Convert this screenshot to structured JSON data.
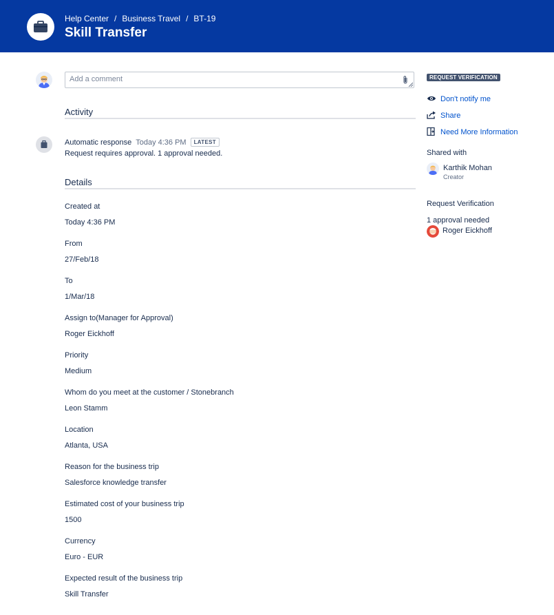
{
  "header": {
    "breadcrumbs": [
      "Help Center",
      "Business Travel",
      "BT-19"
    ],
    "title": "Skill Transfer"
  },
  "comment": {
    "placeholder": "Add a comment"
  },
  "activity": {
    "heading": "Activity",
    "entry": {
      "author": "Automatic response",
      "time": "Today 4:36 PM",
      "badge": "LATEST",
      "message": "Request requires approval. 1 approval needed."
    }
  },
  "details": {
    "heading": "Details",
    "fields": [
      {
        "label": "Created at",
        "value": "Today 4:36 PM"
      },
      {
        "label": "From",
        "value": "27/Feb/18"
      },
      {
        "label": "To",
        "value": "1/Mar/18"
      },
      {
        "label": "Assign to(Manager for Approval)",
        "value": "Roger Eickhoff"
      },
      {
        "label": "Priority",
        "value": "Medium"
      },
      {
        "label": "Whom do you meet at the customer / Stonebranch",
        "value": "Leon Stamm"
      },
      {
        "label": "Location",
        "value": "Atlanta, USA"
      },
      {
        "label": "Reason for the business trip",
        "value": "Salesforce knowledge transfer"
      },
      {
        "label": "Estimated cost of your business trip",
        "value": "1500"
      },
      {
        "label": "Currency",
        "value": "Euro - EUR"
      },
      {
        "label": "Expected result of the business trip",
        "value": "Skill Transfer"
      }
    ]
  },
  "sidebar": {
    "status": "REQUEST VERIFICATION",
    "actions": [
      {
        "label": "Don't notify me",
        "icon": "eye-icon"
      },
      {
        "label": "Share",
        "icon": "share-icon"
      },
      {
        "label": "Need More Information",
        "icon": "transition-icon"
      }
    ],
    "shared_with": {
      "heading": "Shared with",
      "name": "Karthik Mohan",
      "role": "Creator"
    },
    "verification": {
      "heading": "Request Verification",
      "status": "1 approval needed",
      "approver": "Roger Eickhoff"
    }
  },
  "colors": {
    "header_bg": "#0539a1",
    "link": "#0052cc",
    "lozenge": "#42526e"
  }
}
